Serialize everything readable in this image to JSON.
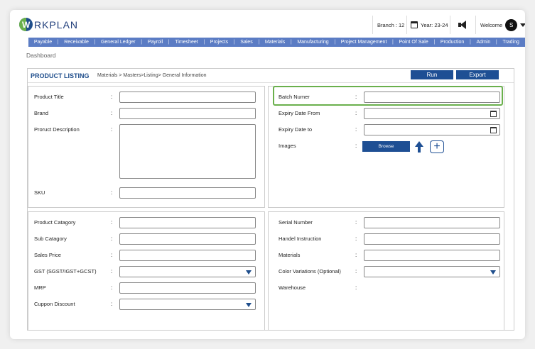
{
  "app": {
    "logo_letter": "W",
    "logo_text": "RKPLAN"
  },
  "topbar": {
    "branch": "Branch : 12",
    "year": "Year: 23-24",
    "welcome": "Welcome",
    "avatar_initial": "S"
  },
  "menu": [
    "Payable",
    "Receivable",
    "General Ledger",
    "Payroll",
    "Timesheet",
    "Projects",
    "Sales",
    "Materials",
    "Manufacturing",
    "Project Management",
    "Point Of Sale",
    "Production",
    "Admin",
    "Trading"
  ],
  "page": {
    "dashboard": "Dashboard",
    "title": "PRODUCT LISTING",
    "breadcrumb": "Materials > Masters>Listing> General Information"
  },
  "actions": {
    "run": "Run",
    "export": "Export"
  },
  "form": {
    "product_title": "Product Title",
    "brand": "Brand",
    "description": "Proruct Description",
    "sku": "SKU",
    "batch": "Batch Numer",
    "expiry_from": "Expiry Date From",
    "expiry_to": "Expiry Date to",
    "images": "Images",
    "browse": "Browse",
    "category": "Product Catagory",
    "sub_category": "Sub Catagory",
    "sales_price": "Sales Price",
    "gst": "GST (SGST/IGST+GCST)",
    "mrp": "MRP",
    "coupon": "Cuppon Discount",
    "serial": "Serial Number",
    "handel": "Handel Instruction",
    "materials": "Materials",
    "color": "Color Variations (Optional)",
    "warehouse": "Warehouse",
    "colon": ":"
  },
  "colors": {
    "accent": "#1e4f94",
    "menu": "#5b7cc4",
    "highlight": "#6ab04c"
  },
  "icons": [
    "calendar-icon",
    "megaphone-icon",
    "chevron-down-icon",
    "upload-arrow-icon",
    "plus-icon"
  ]
}
